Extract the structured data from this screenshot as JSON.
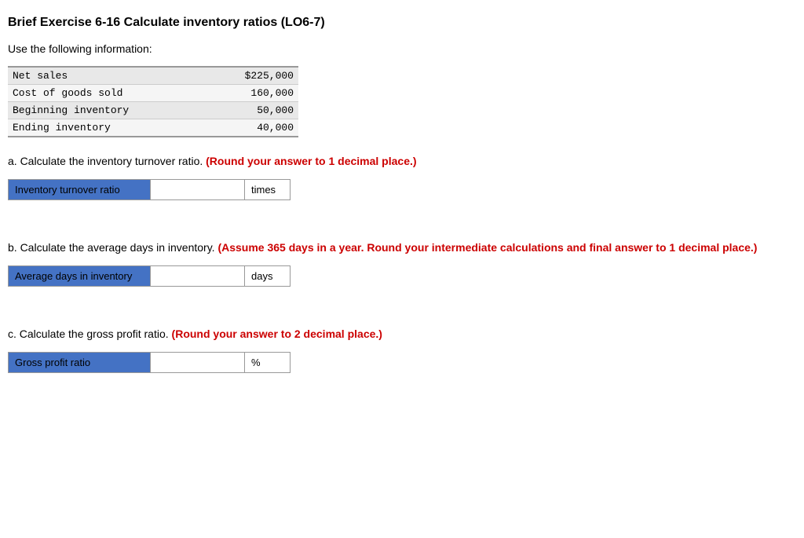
{
  "title": "Brief Exercise 6-16 Calculate inventory ratios (LO6-7)",
  "intro": "Use the following information:",
  "table": {
    "rows": [
      {
        "label": "Net sales",
        "value": "$225,000"
      },
      {
        "label": "Cost of goods sold",
        "value": "160,000"
      },
      {
        "label": "Beginning inventory",
        "value": "50,000"
      },
      {
        "label": "Ending inventory",
        "value": "40,000"
      }
    ]
  },
  "section_a": {
    "question_prefix": "a. Calculate the inventory turnover ratio.",
    "question_highlight": "(Round your answer to 1 decimal place.)",
    "label": "Inventory turnover ratio",
    "unit": "times",
    "input_placeholder": ""
  },
  "section_b": {
    "question_prefix": "b. Calculate the average days in inventory.",
    "question_highlight": "(Assume 365 days in a year. Round your intermediate calculations and final answer to 1 decimal place.)",
    "label": "Average days in inventory",
    "unit": "days",
    "input_placeholder": ""
  },
  "section_c": {
    "question_prefix": "c. Calculate the gross profit ratio.",
    "question_highlight": "(Round your answer to 2 decimal place.)",
    "label": "Gross profit ratio",
    "unit": "%",
    "input_placeholder": ""
  }
}
